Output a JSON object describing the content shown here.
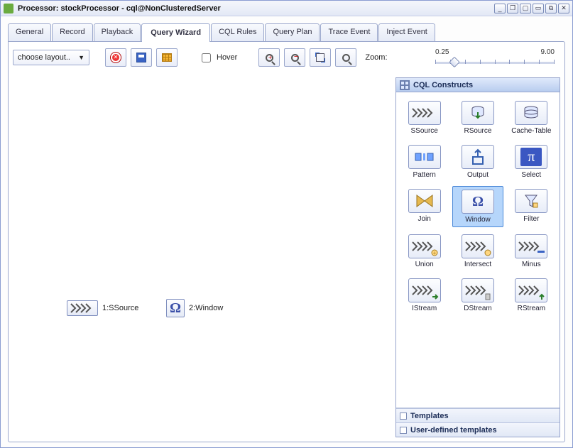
{
  "window": {
    "title": "Processor: stockProcessor - cql@NonClusteredServer"
  },
  "tabs": [
    {
      "label": "General"
    },
    {
      "label": "Record"
    },
    {
      "label": "Playback"
    },
    {
      "label": "Query Wizard",
      "active": true
    },
    {
      "label": "CQL Rules"
    },
    {
      "label": "Query Plan"
    },
    {
      "label": "Trace Event"
    },
    {
      "label": "Inject Event"
    }
  ],
  "toolbar": {
    "layout_label": "choose layout..",
    "hover_label": "Hover",
    "zoom_label": "Zoom:",
    "zoom_min": "0.25",
    "zoom_max": "9.00"
  },
  "canvas": {
    "node1_label": "1:SSource",
    "node2_label": "2:Window"
  },
  "palette": {
    "title": "CQL Constructs",
    "items": [
      {
        "name": "SSource",
        "icon": "chev"
      },
      {
        "name": "RSource",
        "icon": "db-arrow"
      },
      {
        "name": "Cache-Table",
        "icon": "db"
      },
      {
        "name": "Pattern",
        "icon": "pattern"
      },
      {
        "name": "Output",
        "icon": "output"
      },
      {
        "name": "Select",
        "icon": "pi"
      },
      {
        "name": "Join",
        "icon": "bowtie"
      },
      {
        "name": "Window",
        "icon": "omega",
        "selected": true
      },
      {
        "name": "Filter",
        "icon": "filter"
      },
      {
        "name": "Union",
        "icon": "chev-plus"
      },
      {
        "name": "Intersect",
        "icon": "chev-int"
      },
      {
        "name": "Minus",
        "icon": "chev-minus"
      },
      {
        "name": "IStream",
        "icon": "chev-i"
      },
      {
        "name": "DStream",
        "icon": "chev-d"
      },
      {
        "name": "RStream",
        "icon": "chev-r"
      }
    ],
    "sections": {
      "templates": "Templates",
      "user_templates": "User-defined templates"
    }
  }
}
